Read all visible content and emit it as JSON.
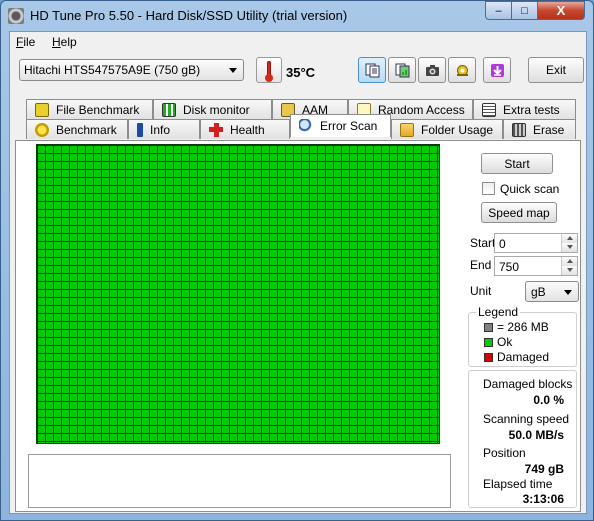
{
  "window": {
    "title": "HD Tune Pro 5.50 - Hard Disk/SSD Utility (trial version)"
  },
  "titlebar_buttons": {
    "minimize": "–",
    "maximize": "□",
    "close": "X"
  },
  "menu": [
    {
      "accel": "F",
      "rest": "ile"
    },
    {
      "accel": "H",
      "rest": "elp"
    }
  ],
  "toolbar": {
    "drive": "Hitachi HTS547575A9E (750 gB)",
    "temperature": "35°C",
    "exit_label": "Exit",
    "buttons": [
      {
        "icon": "copy-text-icon",
        "active": true
      },
      {
        "icon": "copy-screen-icon",
        "active": false
      },
      {
        "icon": "camera-icon",
        "active": false
      },
      {
        "icon": "options-icon",
        "active": false
      },
      {
        "icon": "save-download-icon",
        "active": false
      }
    ]
  },
  "tabs": {
    "row1": [
      {
        "label": "File Benchmark",
        "icon": "file-benchmark-icon"
      },
      {
        "label": "Disk monitor",
        "icon": "disk-monitor-icon"
      },
      {
        "label": "AAM",
        "icon": "speaker-icon"
      },
      {
        "label": "Random Access",
        "icon": "random-access-icon"
      },
      {
        "label": "Extra tests",
        "icon": "extra-tests-icon"
      }
    ],
    "row2": [
      {
        "label": "Benchmark",
        "icon": "benchmark-icon"
      },
      {
        "label": "Info",
        "icon": "info-icon"
      },
      {
        "label": "Health",
        "icon": "health-icon"
      },
      {
        "label": "Error Scan",
        "icon": "magnifier-icon",
        "active": true
      },
      {
        "label": "Folder Usage",
        "icon": "folder-icon"
      },
      {
        "label": "Erase",
        "icon": "trash-icon"
      }
    ]
  },
  "scan_panel": {
    "start_button": "Start",
    "quick_scan_label": "Quick scan",
    "quick_scan_checked": false,
    "speed_map_button": "Speed map",
    "start_label": "Start",
    "start_value": "0",
    "end_label": "End",
    "end_value": "750",
    "unit_label": "Unit",
    "unit_value": "gB"
  },
  "legend": {
    "title": "Legend",
    "block_size": "= 286 MB",
    "ok_label": "Ok",
    "damaged_label": "Damaged",
    "colors": {
      "block": "#808080",
      "ok": "#00cc00",
      "damaged": "#dd0000"
    }
  },
  "stats": {
    "damaged_blocks_label": "Damaged blocks",
    "damaged_blocks_value": "0.0 %",
    "scanning_speed_label": "Scanning speed",
    "scanning_speed_value": "50.0 MB/s",
    "position_label": "Position",
    "position_value": "749 gB",
    "elapsed_label": "Elapsed time",
    "elapsed_value": "3:13:06"
  },
  "scan_grid": {
    "status": "all blocks ok",
    "color": "#00cc00"
  }
}
